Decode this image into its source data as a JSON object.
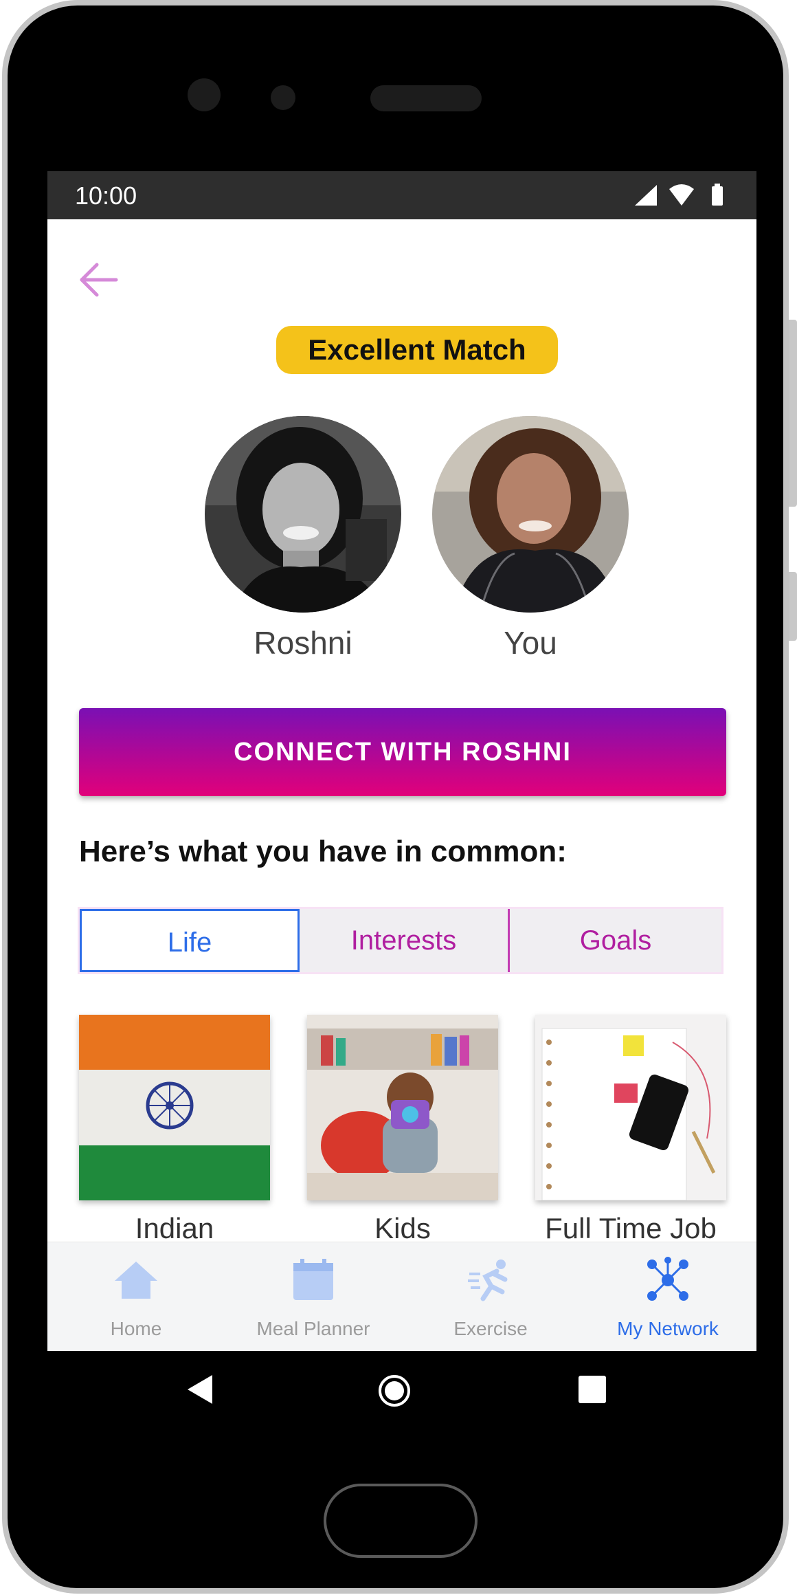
{
  "status_bar": {
    "time": "10:00"
  },
  "match_badge": "Excellent Match",
  "profiles": [
    {
      "name": "Roshni"
    },
    {
      "name": "You"
    }
  ],
  "connect_button": "CONNECT WITH ROSHNI",
  "common_heading": "Here’s what you have in common:",
  "tabs": [
    {
      "label": "Life",
      "active": true
    },
    {
      "label": "Interests",
      "active": false
    },
    {
      "label": "Goals",
      "active": false
    }
  ],
  "cards": [
    {
      "label": "Indian"
    },
    {
      "label": "Kids"
    },
    {
      "label": "Full Time Job"
    }
  ],
  "bottom_nav": [
    {
      "label": "Home",
      "icon": "home-icon",
      "active": false
    },
    {
      "label": "Meal Planner",
      "icon": "calendar-icon",
      "active": false
    },
    {
      "label": "Exercise",
      "icon": "running-icon",
      "active": false
    },
    {
      "label": "My Network",
      "icon": "network-icon",
      "active": true
    }
  ],
  "colors": {
    "accent_blue": "#2d6de8",
    "tab_magenta": "#b01ea0",
    "badge_yellow": "#f4c21a",
    "connect_gradient_top": "#7a10b4",
    "connect_gradient_bottom": "#e2007a",
    "back_arrow": "#d58ad8"
  }
}
